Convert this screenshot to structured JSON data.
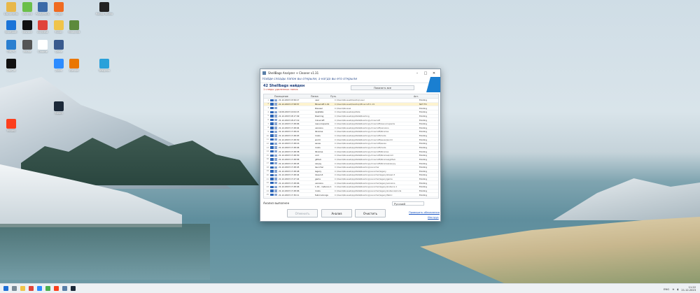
{
  "window": {
    "title": "ShellBags Analyzer + Cleaner v1.31",
    "question": "Найди слоады папок вы открыли, а когда вы его открыли",
    "found_title": "42 Shellbags найден",
    "found_sub": "1 следы удаленных папок",
    "show_button": "Показать все",
    "columns": [
      "Посещение",
      "Папка",
      "Путь",
      "Акт."
    ],
    "rows": [
      {
        "date": "21.12.2023 15:56:17",
        "name": "user",
        "path": "C:\\Users\\Roussel\\Desktop\\user",
        "acc": "Existing"
      },
      {
        "date": "21.12.2023 17:58:57",
        "name": "Minecraft 1.19",
        "path": "C:\\Users\\Roussel\\Desktop\\Minecraft 1.19",
        "acc": "NOT FO"
      },
      {
        "date": "",
        "name": "Roussel",
        "path": "C:\\Users\\Roussel",
        "acc": "Existing"
      },
      {
        "date": "19.09.2023 10:04:15",
        "name": "AppData",
        "path": "C:\\Users\\Roussel\\AppData",
        "acc": "Existing"
      },
      {
        "date": "21.12.2023 18:17:49",
        "name": "Roaming",
        "path": "C:\\Users\\Roussel\\AppData\\Roaming",
        "acc": "Existing"
      },
      {
        "date": "21.12.2023 18:27:19",
        "name": "minecraft",
        "path": "C:\\Users\\Roussel\\AppData\\Roaming\\.minecraft",
        "acc": "Existing"
      },
      {
        "date": "21.12.2023 17:28:06",
        "name": "resourcepacks",
        "path": "C:\\Users\\Roussel\\AppData\\Roaming\\.minecraft\\resourcepacks",
        "acc": "Existing"
      },
      {
        "date": "21.12.2023 17:28:04",
        "name": "versions",
        "path": "C:\\Users\\Roussel\\AppData\\Roaming\\.minecraft\\versions",
        "acc": "Existing"
      },
      {
        "date": "21.12.2023 17:28:21",
        "name": "libraries",
        "path": "C:\\Users\\Roussel\\AppData\\Roaming\\.minecraft\\libraries",
        "acc": "Existing"
      },
      {
        "date": "21.12.2023 17:28:03",
        "name": "mods",
        "path": "C:\\Users\\Roussel\\AppData\\Roaming\\.minecraft\\mods",
        "acc": "Existing"
      },
      {
        "date": "21.12.2023 17:28:30",
        "name": "world",
        "path": "C:\\Users\\Roussel\\AppData\\Roaming\\.minecraft\\saves\\world",
        "acc": "Existing"
      },
      {
        "date": "21.12.2023 17:28:16",
        "name": "saves",
        "path": "C:\\Users\\Roussel\\AppData\\Roaming\\.minecraft\\saves",
        "acc": "Existing"
      },
      {
        "date": "21.12.2023 17:28:46",
        "name": "mods",
        "path": "C:\\Users\\Roussel\\AppData\\Roaming\\.minecraft\\mods",
        "acc": "Existing"
      },
      {
        "date": "21.12.2023 17:28:38",
        "name": "libraries",
        "path": "C:\\Users\\Roussel\\AppData\\Roaming\\.minecraft\\libraries",
        "acc": "Existing"
      },
      {
        "date": "21.12.2023 17:28:30",
        "name": "com",
        "path": "C:\\Users\\Roussel\\AppData\\Roaming\\.minecraft\\libraries\\com",
        "acc": "Existing"
      },
      {
        "date": "21.12.2023 17:28:58",
        "name": "github",
        "path": "C:\\Users\\Roussel\\AppData\\Roaming\\.minecraft\\libraries\\github",
        "acc": "Existing"
      },
      {
        "date": "21.12.2023 17:28:45",
        "name": "xenjoy",
        "path": "C:\\Users\\Roussel\\AppData\\Roaming\\.minecraft\\libraries\\xenjoy",
        "acc": "Existing"
      },
      {
        "date": "21.12.2023 17:28:45",
        "name": "launcher",
        "path": "C:\\Users\\Roussel\\AppData\\Roaming\\.launcher",
        "acc": "Existing"
      },
      {
        "date": "21.12.2023 17:28:48",
        "name": "legacy",
        "path": "C:\\Users\\Roussel\\AppData\\Roaming\\.launcher\\legacy",
        "acc": "Existing"
      },
      {
        "date": "21.12.2023 17:28:44",
        "name": "lolearn3",
        "path": "C:\\Users\\Roussel\\AppData\\Roaming\\.launcher\\legacy\\lolearn3",
        "acc": "Existing"
      },
      {
        "date": "21.12.2023 17:27:44",
        "name": "game",
        "path": "C:\\Users\\Roussel\\AppData\\Roaming\\.launcher\\legacy\\game",
        "acc": "Existing"
      },
      {
        "date": "21.12.2023 17:28:06",
        "name": "versions",
        "path": "C:\\Users\\Roussel\\AppData\\Roaming\\.launcher\\legacy\\versions",
        "acc": "Existing"
      },
      {
        "date": "21.12.2023 17:28:46",
        "name": "1.19 - instance 1",
        "path": "C:\\Users\\Roussel\\AppData\\Roaming\\.launcher\\legacy\\instance 1",
        "acc": "Existing"
      },
      {
        "date": "21.12.2023 17:28:06",
        "name": "mods",
        "path": "C:\\Users\\Roussel\\AppData\\Roaming\\.launcher\\legacy\\instance\\mods",
        "acc": "Existing"
      },
      {
        "date": "21.12.2023 17:30:11",
        "name": "fabricoolongs",
        "path": "C:\\Users\\Roussel\\AppData\\Roaming\\.launcher\\legacy\\fabric",
        "acc": "Existing"
      },
      {
        "date": "21.12.2023 17:28:50",
        "name": "libraries",
        "path": "C:\\Users\\Roussel\\AppData\\Roaming\\.launcher\\legacy\\libraries",
        "acc": "Existing"
      },
      {
        "date": "21.12.2023 17:28:06",
        "name": "config",
        "path": "C:\\Users\\Roussel\\AppData\\Roaming\\.launcher\\legacy\\config",
        "acc": "Existing"
      },
      {
        "date": "21.12.2023 17:28:16",
        "name": "core",
        "path": "C:\\Users\\Roussel\\AppData\\Roaming\\.launcher\\legacy\\core",
        "acc": "Existing"
      },
      {
        "date": "21.12.2023 18:27:19",
        "name": "spotify",
        "path": "C:\\Users\\Roussel\\AppData\\Roaming\\Spotify",
        "acc": "Existing"
      },
      {
        "date": "21.12.2023 18:28:40",
        "name": "Music",
        "path": "C:\\Users\\Roussel\\Music",
        "acc": "Existing"
      },
      {
        "date": "21.12.2023 18:48:29",
        "name": "Downloads",
        "path": "C:\\Users\\Roussel\\Downloads",
        "acc": "Existing"
      }
    ],
    "status": "Анализ выполнен",
    "language": "Русский",
    "buttons": {
      "clean_disabled": "Отменить",
      "analyze": "Анализ",
      "clean": "Очистить"
    },
    "link_update": "Проверить обновления",
    "link_help": "Инструк"
  },
  "desktop": {
    "icons": [
      {
        "label": "Documents",
        "color": "#e8b84a"
      },
      {
        "label": "uTorrent",
        "color": "#6bbf4a"
      },
      {
        "label": "PostgreSQL",
        "color": "#3b6aa8"
      },
      {
        "label": "Origin",
        "color": "#f06b21"
      },
      {
        "label": "Roblox Studio",
        "color": "#222222"
      },
      {
        "label": "Bluetooth",
        "color": "#1a74d8"
      },
      {
        "label": "Discord",
        "color": "#111111"
      },
      {
        "label": "AnyDesk",
        "color": "#e0443a"
      },
      {
        "label": "Folder",
        "color": "#f0c44a"
      },
      {
        "label": "Minecraft",
        "color": "#5d8a3c"
      },
      {
        "label": "This PC",
        "color": "#2a7fd0"
      },
      {
        "label": "Mouse",
        "color": "#555555"
      },
      {
        "label": "Chrome",
        "color": "#ffffff"
      },
      {
        "label": "Game",
        "color": "#3a5b8e"
      },
      {
        "label": "CapCut",
        "color": "#111111"
      },
      {
        "label": "Zoom",
        "color": "#2d8cff"
      },
      {
        "label": "Blender",
        "color": "#ea7600"
      },
      {
        "label": "Steam",
        "color": "#1b2838"
      },
      {
        "label": "Yandex",
        "color": "#fc3f1d"
      },
      {
        "label": "Telegram",
        "color": "#2aa1da"
      }
    ]
  },
  "taskbar": {
    "lang": "ENG",
    "time": "11:22",
    "date": "21.12.2023"
  }
}
